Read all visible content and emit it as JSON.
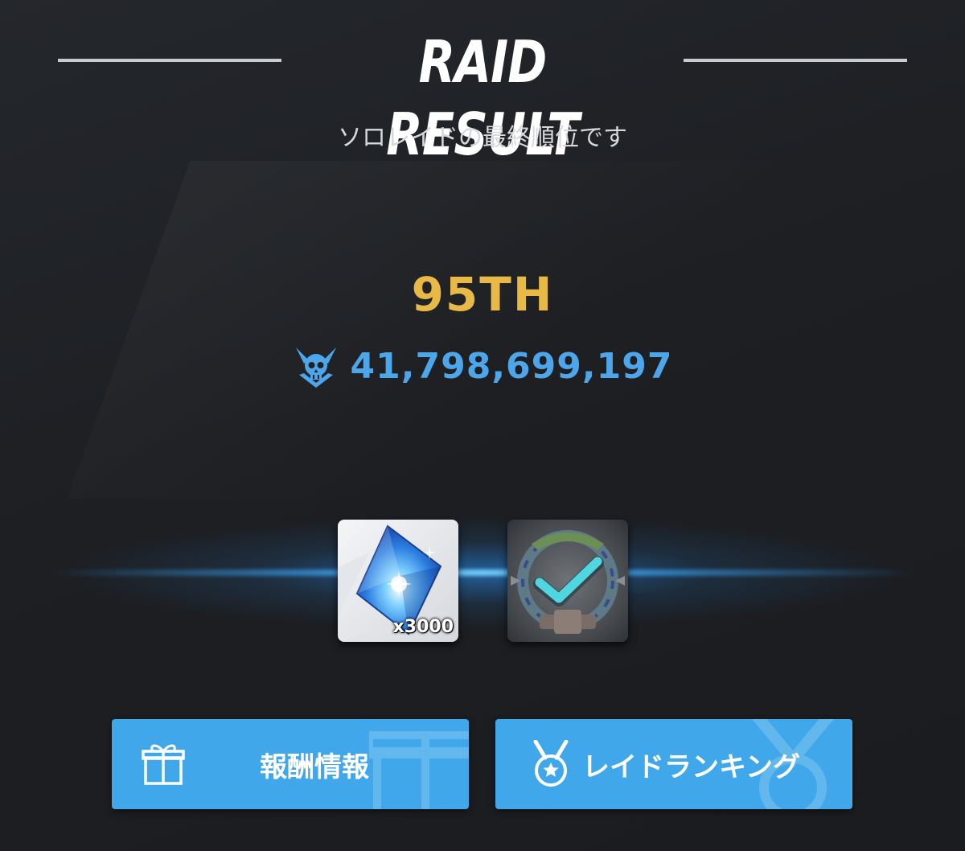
{
  "header": {
    "title": "RAID RESULT",
    "subtitle": "ソロレイドの最終順位です"
  },
  "result": {
    "rank": "95TH",
    "damage_icon": "skull-crest-icon",
    "damage": "41,798,699,197"
  },
  "rewards": [
    {
      "icon": "blue-gem-icon",
      "quantity": "x3000"
    },
    {
      "icon": "completion-badge-check-icon"
    }
  ],
  "buttons": {
    "reward_info": {
      "label": "報酬情報",
      "icon": "gift-icon"
    },
    "raid_ranking": {
      "label": "レイドランキング",
      "icon": "medal-icon"
    }
  },
  "colors": {
    "rank": "#e9b948",
    "damage": "#4ea6ea",
    "button": "#40a8ea",
    "background": "#1e2024",
    "check": "#4fd6e0"
  }
}
